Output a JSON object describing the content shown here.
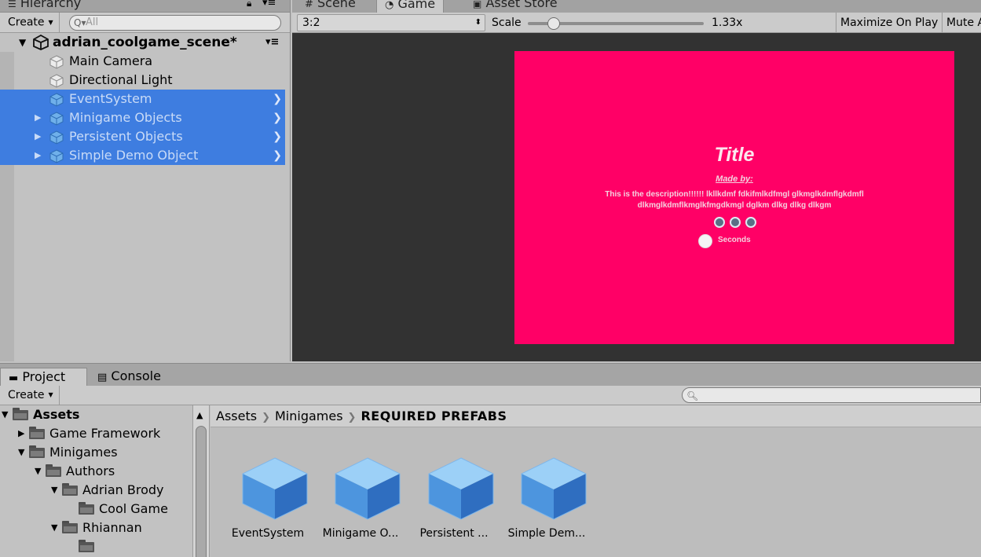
{
  "hierarchy": {
    "tab_label": "Hierarchy",
    "create_label": "Create",
    "search_placeholder": "All",
    "scene_name": "adrian_coolgame_scene*",
    "items": [
      {
        "label": "Main Camera",
        "selected": false,
        "expandable": false
      },
      {
        "label": "Directional Light",
        "selected": false,
        "expandable": false
      },
      {
        "label": "EventSystem",
        "selected": true,
        "expandable": false
      },
      {
        "label": "Minigame Objects",
        "selected": true,
        "expandable": true
      },
      {
        "label": "Persistent Objects",
        "selected": true,
        "expandable": true
      },
      {
        "label": "Simple Demo Object",
        "selected": true,
        "expandable": true
      }
    ]
  },
  "game_view": {
    "tabs": [
      "Scene",
      "Game",
      "Asset Store"
    ],
    "active_tab": "Game",
    "aspect": "3:2",
    "scale_label": "Scale",
    "scale_value": "1.33x",
    "scale_fraction": 0.12,
    "maximize_label": "Maximize On Play",
    "mute_label": "Mute A",
    "canvas": {
      "background": "#ff0066",
      "title": "Title",
      "made_by": "Made by:",
      "description": "This is the description!!!!!! lkllkdmf fdkifmlkdfmgl glkmglkdmflgkdmfl dlkmglkdmflkmglkfmgdkmgl dglkm dlkg dlkg dlkgm",
      "seconds_label": "Seconds"
    }
  },
  "project": {
    "tabs": [
      "Project",
      "Console"
    ],
    "create_label": "Create",
    "tree": [
      {
        "label": "Assets",
        "depth": 0,
        "expanded": true,
        "bold": true
      },
      {
        "label": "Game Framework",
        "depth": 1,
        "expanded": false,
        "bold": false
      },
      {
        "label": "Minigames",
        "depth": 1,
        "expanded": true,
        "bold": false
      },
      {
        "label": "Authors",
        "depth": 2,
        "expanded": true,
        "bold": false
      },
      {
        "label": "Adrian Brody",
        "depth": 3,
        "expanded": true,
        "bold": false
      },
      {
        "label": "Cool Game",
        "depth": 4,
        "expanded": false,
        "bold": false
      },
      {
        "label": "Rhiannan",
        "depth": 3,
        "expanded": true,
        "bold": false
      }
    ],
    "breadcrumb": [
      "Assets",
      "Minigames",
      "REQUIRED PREFABS"
    ],
    "assets": [
      "EventSystem",
      "Minigame O...",
      "Persistent ...",
      "Simple Dem..."
    ]
  },
  "colors": {
    "selection": "#3e7de0",
    "panel": "#c2c2c2",
    "game_background": "#323232"
  }
}
